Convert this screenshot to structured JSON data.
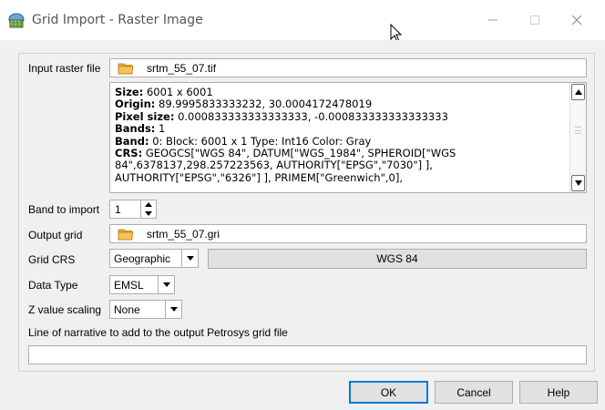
{
  "window": {
    "title": "Grid Import - Raster Image"
  },
  "form": {
    "input_raster_label": "Input raster file",
    "input_raster_value": "srtm_55_07.tif",
    "info_lines": [
      {
        "key": "Size:",
        "value": " 6001 x 6001"
      },
      {
        "key": "Origin:",
        "value": " 89.9995833333232, 30.0004172478019"
      },
      {
        "key": "Pixel size:",
        "value": " 0.000833333333333333, -0.000833333333333333"
      },
      {
        "key": "Bands:",
        "value": " 1"
      },
      {
        "key": "Band:",
        "value": " 0: Block: 6001 x 1 Type: Int16 Color: Gray"
      },
      {
        "key": "CRS:",
        "value": " GEOGCS[\"WGS 84\", DATUM[\"WGS_1984\", SPHEROID[\"WGS"
      },
      {
        "key": "",
        "value": "84\",6378137,298.257223563, AUTHORITY[\"EPSG\",\"7030\"] ],"
      },
      {
        "key": "",
        "value": "AUTHORITY[\"EPSG\",\"6326\"] ], PRIMEM[\"Greenwich\",0],"
      }
    ],
    "band_label": "Band to import",
    "band_value": "1",
    "output_grid_label": "Output grid",
    "output_grid_value": "srtm_55_07.gri",
    "grid_crs_label": "Grid CRS",
    "grid_crs_type": "Geographic",
    "grid_crs_name": "WGS 84",
    "data_type_label": "Data Type",
    "data_type_value": "EMSL",
    "z_scaling_label": "Z value scaling",
    "z_scaling_value": "None",
    "narrative_label": "Line of narrative to add to the output Petrosys grid file",
    "narrative_value": ""
  },
  "buttons": {
    "ok": "OK",
    "cancel": "Cancel",
    "help": "Help"
  },
  "colors": {
    "accent": "#0078d7",
    "folder": "#e8a628"
  }
}
